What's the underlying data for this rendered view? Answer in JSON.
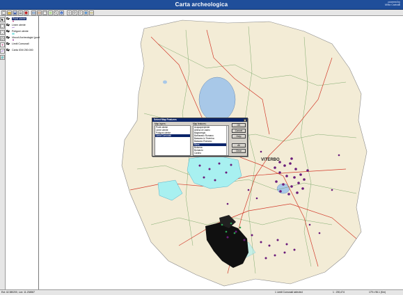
{
  "window": {
    "title": "Carta archeologica",
    "brand_line1": "powered by",
    "brand_line2": "Mirko Cavicalli"
  },
  "toolbar": {
    "icons": [
      "new-icon",
      "open-icon",
      "save-icon",
      "print-icon",
      "stop-icon",
      "layer-add-icon",
      "layer-remove-icon",
      "table-icon",
      "map-icon",
      "query-icon",
      "info-icon",
      "pan-icon",
      "zoom-in-icon",
      "zoom-out-icon",
      "full-extent-icon",
      "measure-icon"
    ]
  },
  "legend": {
    "layers": [
      {
        "label": "Punti utente",
        "selected": true,
        "symbol": "point",
        "color": "#c04080"
      },
      {
        "label": "Linee utente",
        "selected": false,
        "symbol": "line",
        "color": "#8040c0"
      },
      {
        "label": "Poligoni utente",
        "selected": false,
        "symbol": "polygon",
        "color": "#80e0e0"
      },
      {
        "label": "Vincoli Archeologici (punti)",
        "selected": false,
        "symbol": "point",
        "color": "#a040a0"
      },
      {
        "label": "Limiti Comunali",
        "selected": false,
        "symbol": "line",
        "color": "#a0a0a0"
      },
      {
        "label": "Carta IGM 250.000",
        "selected": false,
        "symbol": "raster",
        "color": "#d0c080"
      }
    ]
  },
  "map": {
    "labels": [
      "VITERBO"
    ],
    "colors": {
      "land": "#f3ecd6",
      "water": "#a8c8e8",
      "road": "#d23a2a",
      "admin": "#6a9e5a",
      "points": "#6a1a7a",
      "highlight": "#a8f0f0",
      "dark_area": "#101010"
    }
  },
  "dialog": {
    "title": "Select Map Features",
    "close": "×",
    "map_layers_caption": "Map layers:",
    "map_features_caption": "Map features:",
    "map_layers": [
      {
        "label": "Punti utente",
        "selected": false
      },
      {
        "label": "Linee utente",
        "selected": false
      },
      {
        "label": "Poligoni utente",
        "selected": false
      },
      {
        "label": "Limiti Comunali",
        "selected": true
      }
    ],
    "map_features": [
      {
        "label": "Acquapendente",
        "selected": false
      },
      {
        "label": "Arlena di Castro",
        "selected": false
      },
      {
        "label": "Bagnoregio",
        "selected": false
      },
      {
        "label": "Barbarano Romano",
        "selected": false
      },
      {
        "label": "Bassano in Teverina",
        "selected": false
      },
      {
        "label": "Bassano Romano",
        "selected": false
      },
      {
        "label": "Blera",
        "selected": true
      },
      {
        "label": "Bolsena",
        "selected": false
      },
      {
        "label": "Bomarzo",
        "selected": false
      },
      {
        "label": "Canino",
        "selected": false
      }
    ],
    "buttons": {
      "ok": "OK",
      "cancel": "Cancel",
      "help": "Help",
      "all": "All",
      "clear": "Clear"
    }
  },
  "status": {
    "coords": "Est: 42.380200, Lon: 11.234567",
    "selection": "1 Limiti Comunali selected",
    "scale": "1 : 200,474",
    "extent": "179 x 96.1 (Km)"
  }
}
